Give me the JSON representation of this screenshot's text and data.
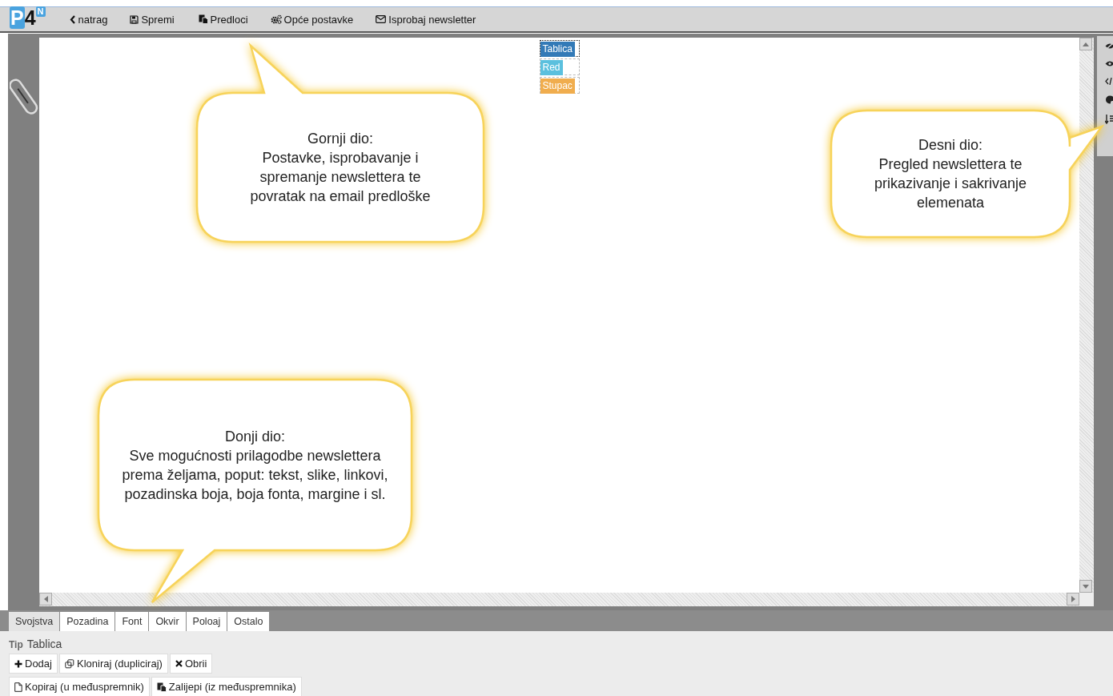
{
  "toolbar": {
    "logo": {
      "text": "P4",
      "badge": "N"
    },
    "buttons": [
      {
        "label": "natrag"
      },
      {
        "label": "Spremi"
      },
      {
        "label": "Predloci"
      },
      {
        "label": "Opće postavke"
      },
      {
        "label": "Isprobaj newsletter"
      }
    ]
  },
  "element_tags": [
    {
      "label": "Tablica",
      "color": "#337ab7",
      "selected": true
    },
    {
      "label": "Red",
      "color": "#5bc0de",
      "selected": false
    },
    {
      "label": "Stupac",
      "color": "#f0ad4e",
      "selected": false
    }
  ],
  "callouts": [
    {
      "title": "Gornji dio:",
      "text": "Postavke, isprobavanje i spremanje newslettera te povratak na email predloške",
      "kind": "up"
    },
    {
      "title": "Desni dio:",
      "text": "Pregled newslettera te prikazivanje i sakrivanje elemenata",
      "kind": "right"
    },
    {
      "title": "Donji dio:",
      "text": "Sve mogućnosti prilagodbe newslettera prema željama, poput: tekst, slike, linkovi, pozadinska boja, boja fonta, margine i sl.",
      "kind": "down"
    }
  ],
  "tabs": [
    {
      "label": "Svojstva",
      "selected": true
    },
    {
      "label": "Pozadina",
      "selected": false
    },
    {
      "label": "Font",
      "selected": false
    },
    {
      "label": "Okvir",
      "selected": false
    },
    {
      "label": "Poloaj",
      "selected": false
    },
    {
      "label": "Ostalo",
      "selected": false
    }
  ],
  "type_field": {
    "label": "Tip",
    "value": "Tablica"
  },
  "action_rows": [
    [
      {
        "label": "Dodaj"
      },
      {
        "label": "Kloniraj (dupliciraj)"
      },
      {
        "label": "Obrii"
      }
    ],
    [
      {
        "label": "Kopiraj (u međuspremnik)"
      },
      {
        "label": "Zalijepi (iz međuspremnika)"
      }
    ]
  ]
}
